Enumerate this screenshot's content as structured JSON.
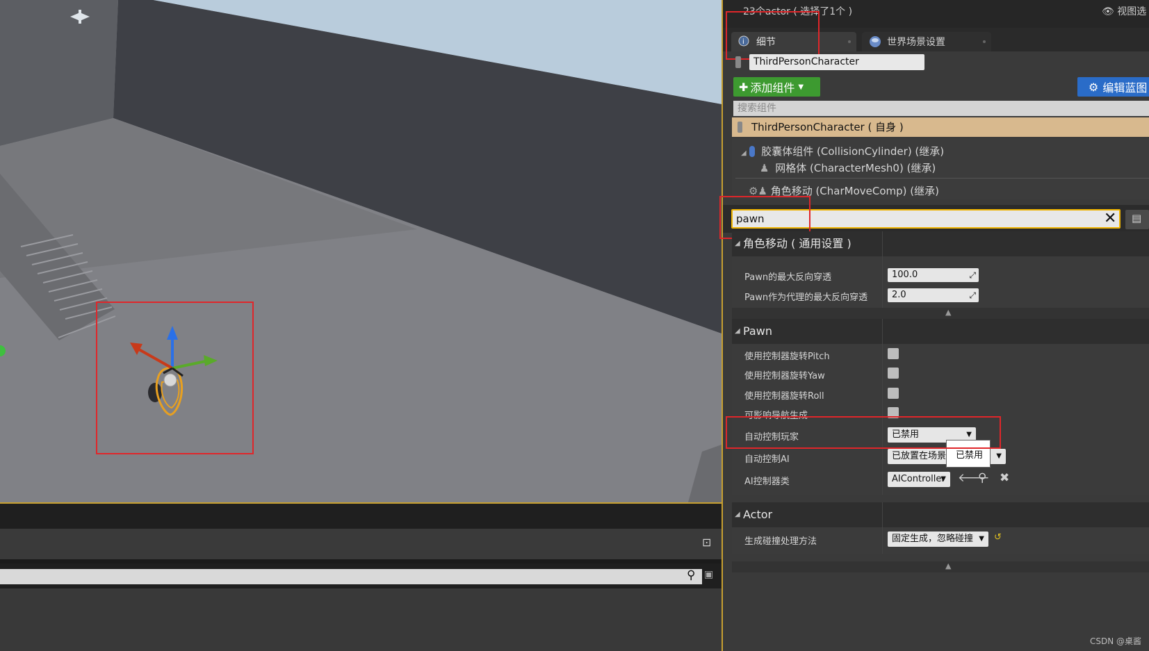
{
  "header": {
    "title": "23个actor ( 选择了1个 )",
    "view_options": "视图选"
  },
  "tabs": [
    {
      "label": "细节",
      "icon": "info-search-icon"
    },
    {
      "label": "世界场景设置",
      "icon": "globe-icon"
    }
  ],
  "actor_name": "ThirdPersonCharacter",
  "toolbar": {
    "add_component": "添加组件",
    "edit_blueprint": "编辑蓝图"
  },
  "component_search_placeholder": "搜索组件",
  "components": {
    "self": "ThirdPersonCharacter ( 自身 )",
    "capsule": "胶囊体组件 (CollisionCylinder) (继承)",
    "mesh": "网格体 (CharacterMesh0) (继承)",
    "movement": "角色移动 (CharMoveComp) (继承)"
  },
  "details_search": {
    "value": "pawn"
  },
  "categories": {
    "movement": {
      "title": "角色移动 ( 通用设置 )",
      "props": [
        {
          "label": "Pawn的最大反向穿透",
          "value": "100.0"
        },
        {
          "label": "Pawn作为代理的最大反向穿透",
          "value": "2.0"
        }
      ]
    },
    "pawn": {
      "title": "Pawn",
      "checkbox_props": [
        "使用控制器旋转Pitch",
        "使用控制器旋转Yaw",
        "使用控制器旋转Roll",
        "可影响导航生成"
      ],
      "auto_possess_player": {
        "label": "自动控制玩家",
        "value": "已禁用"
      },
      "auto_possess_ai": {
        "label": "自动控制AI",
        "value": "已放置在场景"
      },
      "ai_controller_class": {
        "label": "AI控制器类",
        "value": "AIController"
      }
    },
    "actor": {
      "title": "Actor",
      "spawn_collision": {
        "label": "生成碰撞处理方法",
        "value": "固定生成，忽略碰撞"
      }
    }
  },
  "dropdown_popup": "已禁用",
  "watermark": "CSDN @桌酱",
  "colors": {
    "accent_border": "#c8a030",
    "add_button": "#3d9a30",
    "edit_blueprint": "#2a6cc8",
    "selection": "#d8b98e",
    "annotation_red": "#e0262a"
  }
}
